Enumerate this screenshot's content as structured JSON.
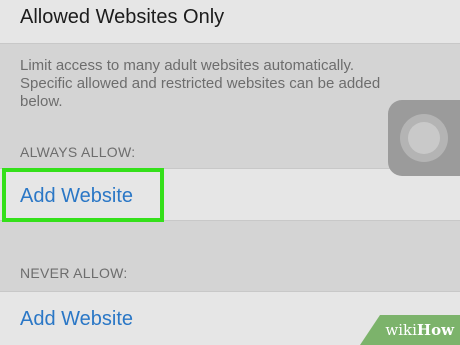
{
  "header": {
    "title": "Allowed Websites Only"
  },
  "description": {
    "line1": "Limit access to many adult websites automatically.",
    "line2": "Specific allowed and restricted websites can be added",
    "line3": "below."
  },
  "always_allow": {
    "header": "ALWAYS ALLOW:",
    "add_label": "Add Website"
  },
  "never_allow": {
    "header": "NEVER ALLOW:",
    "add_label": "Add Website"
  },
  "assistive_touch": {
    "icon": "assistive-touch-icon"
  },
  "watermark": {
    "prefix": "wiki",
    "suffix": "How"
  },
  "colors": {
    "link": "#2a77c6",
    "highlight": "#34e01a",
    "background": "#d4d4d4",
    "row": "#e6e6e6"
  }
}
